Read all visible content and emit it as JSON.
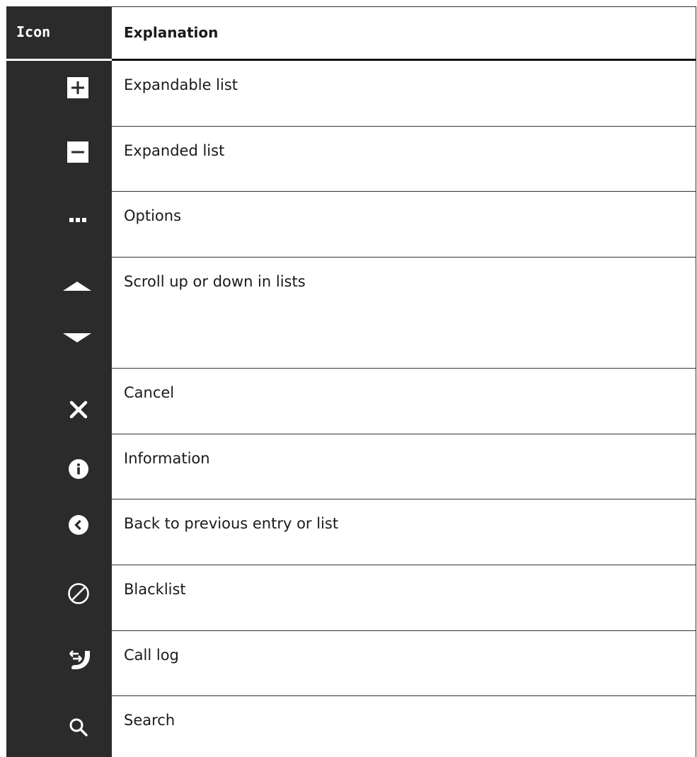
{
  "table": {
    "header": {
      "icon_col": "Icon",
      "explanation_col": "Explanation"
    },
    "rows": [
      {
        "icon": "plus-box-icon",
        "label": "Expandable list"
      },
      {
        "icon": "minus-box-icon",
        "label": "Expanded list"
      },
      {
        "icon": "more-dots-icon",
        "label": "Options"
      },
      {
        "icon": "scroll-arrows-icon",
        "label": "Scroll up or down in lists"
      },
      {
        "icon": "close-x-icon",
        "label": "Cancel"
      },
      {
        "icon": "info-circle-icon",
        "label": "Information"
      },
      {
        "icon": "back-chevron-circle-icon",
        "label": "Back to previous entry or list"
      },
      {
        "icon": "blocked-circle-icon",
        "label": "Blacklist"
      },
      {
        "icon": "call-log-icon",
        "label": "Call log"
      },
      {
        "icon": "search-icon",
        "label": "Search"
      }
    ]
  },
  "colors": {
    "icon_column_bg": "#2b2b2b",
    "icon_color": "#ffffff",
    "text_color": "#1a1a1a",
    "rule_color": "#111111"
  }
}
